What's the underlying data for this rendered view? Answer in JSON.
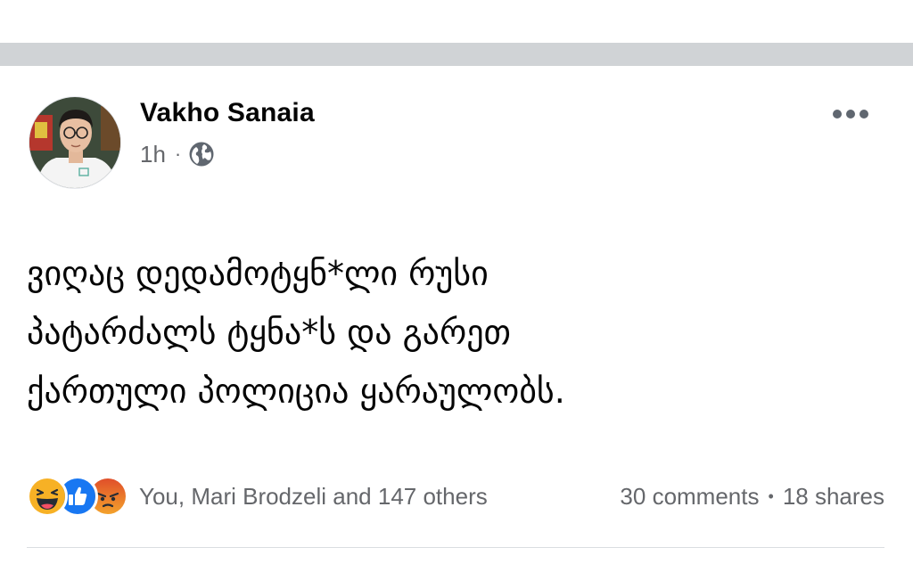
{
  "post": {
    "author": "Vakho Sanaia",
    "time": "1h",
    "separator": "·",
    "audience_icon": "globe-icon",
    "text": "ვიღაც დედამოტყნ*ლი რუსი\nპატარძალს ტყნა*ს და გარეთ\nქართული პოლიცია ყარაულობს.",
    "reactions": {
      "icons": [
        "haha-icon",
        "like-icon",
        "angry-icon"
      ],
      "names": "You, Mari Brodzeli and 147 others"
    },
    "comments": "30 comments",
    "counts_separator": "•",
    "shares": "18 shares"
  },
  "colors": {
    "separator_bar": "#d0d3d6",
    "secondary_text": "#65676b",
    "like_blue": "#1877f2",
    "haha_yellow": "#f7b125",
    "angry_orange": "#e9710f"
  }
}
